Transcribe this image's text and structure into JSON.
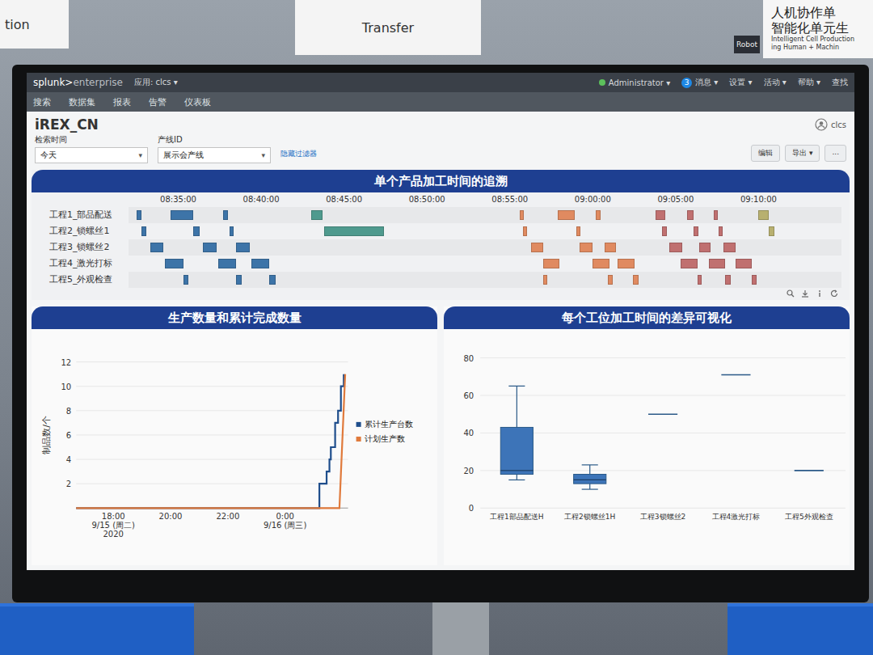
{
  "scene": {
    "signs": [
      "tion",
      "Transfer"
    ],
    "tag": "Robot",
    "banner": {
      "lines": [
        "人机协作单",
        "智能化单元生"
      ],
      "english": [
        "Intelligent Cell Production",
        "ing Human + Machin"
      ]
    }
  },
  "topbar": {
    "logo_main": "splunk>",
    "logo_sub": "enterprise",
    "app": "应用: clcs ▾",
    "user": "Administrator ▾",
    "messages_count": "3",
    "messages": "消息 ▾",
    "menus": [
      "设置 ▾",
      "活动 ▾",
      "帮助 ▾"
    ],
    "find": "查找"
  },
  "nav": [
    {
      "label": "搜索",
      "selected": false
    },
    {
      "label": "数据集",
      "selected": false
    },
    {
      "label": "报表",
      "selected": false
    },
    {
      "label": "告警",
      "selected": false
    },
    {
      "label": "仪表板",
      "selected": false
    }
  ],
  "dashboard": {
    "title": "iREX_CN",
    "user": "clcs",
    "buttons": [
      "编辑",
      "导出 ▾",
      "..."
    ]
  },
  "filters": [
    {
      "label": "检索时间",
      "value": "今天",
      "caret": "▾"
    },
    {
      "label": "产线ID",
      "value": "展示会产线",
      "caret": "▾"
    }
  ],
  "hide_filters": "隐藏过滤器",
  "gantt": {
    "title": "单个产品加工时间的追溯",
    "ticks": [
      {
        "at": 3,
        "label": "08:35:00"
      },
      {
        "at": 8,
        "label": "08:40:00"
      },
      {
        "at": 13,
        "label": "08:45:00"
      },
      {
        "at": 18,
        "label": "08:50:00"
      },
      {
        "at": 23,
        "label": "08:55:00"
      },
      {
        "at": 28,
        "label": "09:00:00"
      },
      {
        "at": 33,
        "label": "09:05:00"
      },
      {
        "at": 38,
        "label": "09:10:00"
      }
    ],
    "rows": [
      {
        "label": "工程1_部品配送",
        "bars": [
          {
            "start": 0.5,
            "end": 0.8,
            "color": "#3d74a8"
          },
          {
            "start": 2.55,
            "end": 3.9,
            "color": "#3d74a8"
          },
          {
            "start": 5.7,
            "end": 6.0,
            "color": "#3d74a8"
          },
          {
            "start": 11.0,
            "end": 11.7,
            "color": "#4f9a8e"
          },
          {
            "start": 23.6,
            "end": 23.85,
            "color": "#e08a60"
          },
          {
            "start": 25.9,
            "end": 26.9,
            "color": "#e08a60"
          },
          {
            "start": 28.2,
            "end": 28.45,
            "color": "#e08a60"
          },
          {
            "start": 31.8,
            "end": 32.35,
            "color": "#c07070"
          },
          {
            "start": 33.7,
            "end": 34.1,
            "color": "#c07070"
          },
          {
            "start": 35.3,
            "end": 35.55,
            "color": "#c07070"
          },
          {
            "start": 38.0,
            "end": 38.6,
            "color": "#b8b070"
          }
        ]
      },
      {
        "label": "工程2_锁螺丝1",
        "bars": [
          {
            "start": 0.8,
            "end": 1.05,
            "color": "#3d74a8"
          },
          {
            "start": 3.9,
            "end": 4.3,
            "color": "#3d74a8"
          },
          {
            "start": 6.1,
            "end": 6.35,
            "color": "#3d74a8"
          },
          {
            "start": 11.8,
            "end": 15.4,
            "color": "#4f9a8e"
          },
          {
            "start": 23.8,
            "end": 24.05,
            "color": "#e08a60"
          },
          {
            "start": 27.0,
            "end": 27.25,
            "color": "#e08a60"
          },
          {
            "start": 32.2,
            "end": 32.45,
            "color": "#c07070"
          },
          {
            "start": 34.1,
            "end": 34.35,
            "color": "#c07070"
          },
          {
            "start": 35.6,
            "end": 35.85,
            "color": "#c07070"
          },
          {
            "start": 38.6,
            "end": 38.95,
            "color": "#b8b070"
          }
        ]
      },
      {
        "label": "工程3_锁螺丝2",
        "bars": [
          {
            "start": 1.3,
            "end": 2.1,
            "color": "#3d74a8"
          },
          {
            "start": 4.5,
            "end": 5.3,
            "color": "#3d74a8"
          },
          {
            "start": 6.5,
            "end": 7.3,
            "color": "#3d74a8"
          },
          {
            "start": 24.3,
            "end": 25.0,
            "color": "#e08a60"
          },
          {
            "start": 27.2,
            "end": 28.0,
            "color": "#e08a60"
          },
          {
            "start": 28.7,
            "end": 29.4,
            "color": "#e08a60"
          },
          {
            "start": 32.6,
            "end": 33.4,
            "color": "#c07070"
          },
          {
            "start": 34.4,
            "end": 35.1,
            "color": "#c07070"
          },
          {
            "start": 35.9,
            "end": 36.6,
            "color": "#c07070"
          }
        ]
      },
      {
        "label": "工程4_激光打标",
        "bars": [
          {
            "start": 2.2,
            "end": 3.3,
            "color": "#3d74a8"
          },
          {
            "start": 5.4,
            "end": 6.5,
            "color": "#3d74a8"
          },
          {
            "start": 7.4,
            "end": 8.5,
            "color": "#3d74a8"
          },
          {
            "start": 25.0,
            "end": 26.0,
            "color": "#e08a60"
          },
          {
            "start": 28.0,
            "end": 29.0,
            "color": "#e08a60"
          },
          {
            "start": 29.5,
            "end": 30.5,
            "color": "#e08a60"
          },
          {
            "start": 33.3,
            "end": 34.3,
            "color": "#c07070"
          },
          {
            "start": 35.0,
            "end": 36.0,
            "color": "#c07070"
          },
          {
            "start": 36.6,
            "end": 37.6,
            "color": "#c07070"
          }
        ]
      },
      {
        "label": "工程5_外观检查",
        "bars": [
          {
            "start": 3.3,
            "end": 3.6,
            "color": "#3d74a8"
          },
          {
            "start": 6.5,
            "end": 6.85,
            "color": "#3d74a8"
          },
          {
            "start": 8.5,
            "end": 8.85,
            "color": "#3d74a8"
          },
          {
            "start": 25.0,
            "end": 25.25,
            "color": "#e08a60"
          },
          {
            "start": 28.9,
            "end": 29.2,
            "color": "#e08a60"
          },
          {
            "start": 30.4,
            "end": 30.75,
            "color": "#e08a60"
          },
          {
            "start": 34.3,
            "end": 34.55,
            "color": "#c07070"
          },
          {
            "start": 36.0,
            "end": 36.3,
            "color": "#c07070"
          },
          {
            "start": 37.6,
            "end": 37.9,
            "color": "#c07070"
          }
        ]
      }
    ]
  },
  "line_chart": {
    "title": "生产数量和累计完成数量",
    "y_label": "制品数/个",
    "y_ticks": [
      "2",
      "4",
      "6",
      "8",
      "10",
      "12"
    ],
    "x_ticks": [
      {
        "at": 18,
        "lines": [
          "18:00",
          "9/15 (周二)",
          "2020"
        ]
      },
      {
        "at": 20,
        "lines": [
          "20:00"
        ]
      },
      {
        "at": 22,
        "lines": [
          "22:00"
        ]
      },
      {
        "at": 24,
        "lines": [
          "0:00",
          "9/16 (周三)"
        ]
      }
    ],
    "series": [
      {
        "name": "累计生产台数",
        "color": "#1f4e8c",
        "points": [
          [
            16.7,
            0
          ],
          [
            25.2,
            0
          ],
          [
            25.2,
            2
          ],
          [
            25.45,
            2
          ],
          [
            25.45,
            3
          ],
          [
            25.55,
            3
          ],
          [
            25.55,
            4
          ],
          [
            25.6,
            4
          ],
          [
            25.6,
            5
          ],
          [
            25.75,
            5
          ],
          [
            25.75,
            7
          ],
          [
            25.85,
            7
          ],
          [
            25.85,
            8
          ],
          [
            25.95,
            8
          ],
          [
            25.95,
            10
          ],
          [
            26.05,
            10
          ],
          [
            26.05,
            11
          ]
        ]
      },
      {
        "name": "计划生产数",
        "color": "#e07a3c",
        "points": [
          [
            16.7,
            0
          ],
          [
            25.9,
            0
          ],
          [
            26.1,
            11
          ]
        ]
      }
    ]
  },
  "box_chart": {
    "title": "每个工位加工时间的差异可视化",
    "y_ticks": [
      "0",
      "20",
      "40",
      "60",
      "80"
    ],
    "categories": [
      {
        "label": "工程1部品配送H",
        "min": 15,
        "q1": 18,
        "median": 20,
        "q3": 43,
        "max": 65
      },
      {
        "label": "工程2锁螺丝1H",
        "min": 10,
        "q1": 13,
        "median": 15,
        "q3": 18,
        "max": 23
      },
      {
        "label": "工程3锁螺丝2",
        "min": 50,
        "q1": 50,
        "median": 50,
        "q3": 50,
        "max": 50
      },
      {
        "label": "工程4激光打标",
        "min": 71,
        "q1": 71,
        "median": 71,
        "q3": 71,
        "max": 71
      },
      {
        "label": "工程5外观检查",
        "min": 20,
        "q1": 20,
        "median": 20,
        "q3": 20,
        "max": 20
      }
    ]
  }
}
